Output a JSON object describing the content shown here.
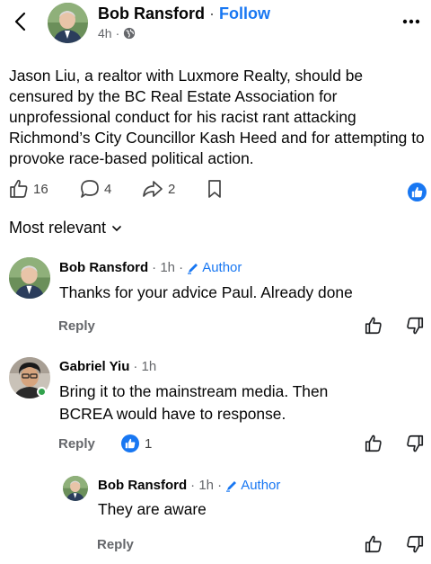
{
  "post": {
    "author": "Bob Ransford",
    "separator": " · ",
    "follow_label": "Follow",
    "time": "4h",
    "privacy_icon": "globe-icon",
    "text": "Jason Liu, a realtor with Luxmore Realty, should be censured by the BC Real Estate Association for unprofessional conduct for his racist rant attacking Richmond’s City Councillor Kash Heed and for attempting to provoke race-based political action.",
    "like_count": "16",
    "comment_count": "4",
    "share_count": "2"
  },
  "sort": {
    "label": "Most relevant"
  },
  "comments": [
    {
      "author": "Bob Ransford",
      "time": "· 1h ·",
      "badge": "Author",
      "text": "Thanks for your advice Paul. Already done",
      "reply_label": "Reply"
    },
    {
      "author": "Gabriel Yiu",
      "time": "· 1h",
      "text_line1": "Bring it to the mainstream media. Then",
      "text_line2": "BCREA would have to response.",
      "reply_label": "Reply",
      "like_count": "1"
    },
    {
      "author": "Bob Ransford",
      "time": "· 1h ·",
      "badge": "Author",
      "text": "They are aware",
      "reply_label": "Reply"
    }
  ],
  "colors": {
    "accent": "#1877f2",
    "muted": "#65676b",
    "online": "#31a24c"
  }
}
